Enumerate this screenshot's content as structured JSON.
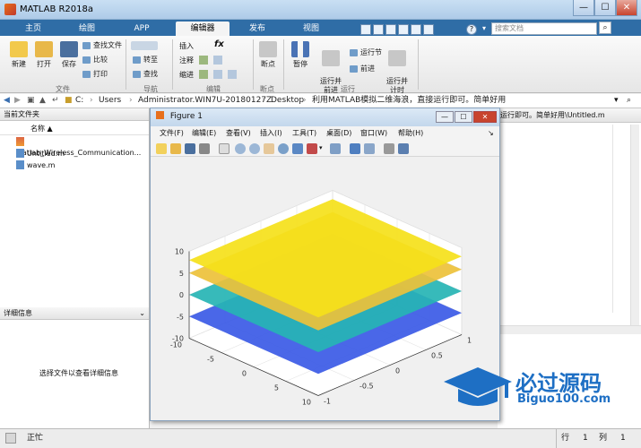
{
  "app": {
    "title": "MATLAB R2018a"
  },
  "window_controls": {
    "minimize": "—",
    "maximize": "☐",
    "close": "✕"
  },
  "quick_access": [
    "?",
    "▾"
  ],
  "search": {
    "placeholder": "搜索文档"
  },
  "tabs": [
    "主页",
    "绘图",
    "APP",
    "编辑器",
    "发布",
    "视图"
  ],
  "ribbon": {
    "file": {
      "new": "新建",
      "open": "打开",
      "save": "保存",
      "find_files": "查找文件",
      "compare": "比较",
      "print": "打印",
      "group": "文件"
    },
    "navigate": {
      "goto": "转至",
      "find": "查找",
      "group": "导航"
    },
    "edit": {
      "insert": "插入",
      "comment": "注释",
      "indent": "缩进",
      "fx": "fx",
      "group": "编辑"
    },
    "breakpoints": {
      "label": "断点",
      "group": "断点"
    },
    "run": {
      "pause": "暂停",
      "run_advance": "运行并\n前进",
      "run_section": "运行节",
      "advance": "前进",
      "run_time": "运行并\n计时",
      "group": "运行"
    }
  },
  "address": {
    "path": [
      "C:",
      "Users",
      "Administrator.WIN7U-20180127Z",
      "Desktop",
      "利用MATLAB模拟二维海浪，直接运行即可。简单好用"
    ]
  },
  "current_folder": {
    "title": "当前文件夹",
    "column": "名称 ▲",
    "files": [
      "Matlab_Wireless_Communication...",
      "Untitled.m",
      "wave.m"
    ]
  },
  "details": {
    "title": "详细信息",
    "message": "选择文件以查看详细信息"
  },
  "editor_tab": {
    "label": "运行即可。简单好用\\Untitled.m"
  },
  "figure": {
    "title": "Figure 1",
    "menu": [
      "文件(F)",
      "编辑(E)",
      "查看(V)",
      "插入(I)",
      "工具(T)",
      "桌面(D)",
      "窗口(W)",
      "帮助(H)"
    ]
  },
  "status": {
    "text": "正忙",
    "row_label": "行",
    "row_value": "1",
    "col_label": "列",
    "col_value": "1"
  },
  "watermark": {
    "main": "必过源码",
    "sub": "Biguo100.com"
  },
  "colors": {
    "tab_bar": "#2f6da6",
    "layer_top": "#f5e11a",
    "layer_2": "#e8b845",
    "layer_3": "#2cb7b0",
    "layer_4": "#3b58e6"
  },
  "chart_data": {
    "type": "surface",
    "title": "",
    "z_ticks": [
      "10",
      "5",
      "0",
      "-5",
      "-10"
    ],
    "x_ticks": [
      "-10",
      "-5",
      "0",
      "5",
      "10"
    ],
    "y_ticks": [
      "-1",
      "-0.5",
      "0",
      "0.5",
      "1"
    ],
    "zlim": [
      -10,
      10
    ],
    "xlim": [
      -10,
      10
    ],
    "ylim": [
      -1,
      1
    ],
    "series": [
      {
        "z": 8,
        "color": "#f5e11a"
      },
      {
        "z": 5,
        "color": "#edc13a"
      },
      {
        "z": 0,
        "color": "#26b4b4"
      },
      {
        "z": -5,
        "color": "#3b5ae6"
      }
    ]
  }
}
